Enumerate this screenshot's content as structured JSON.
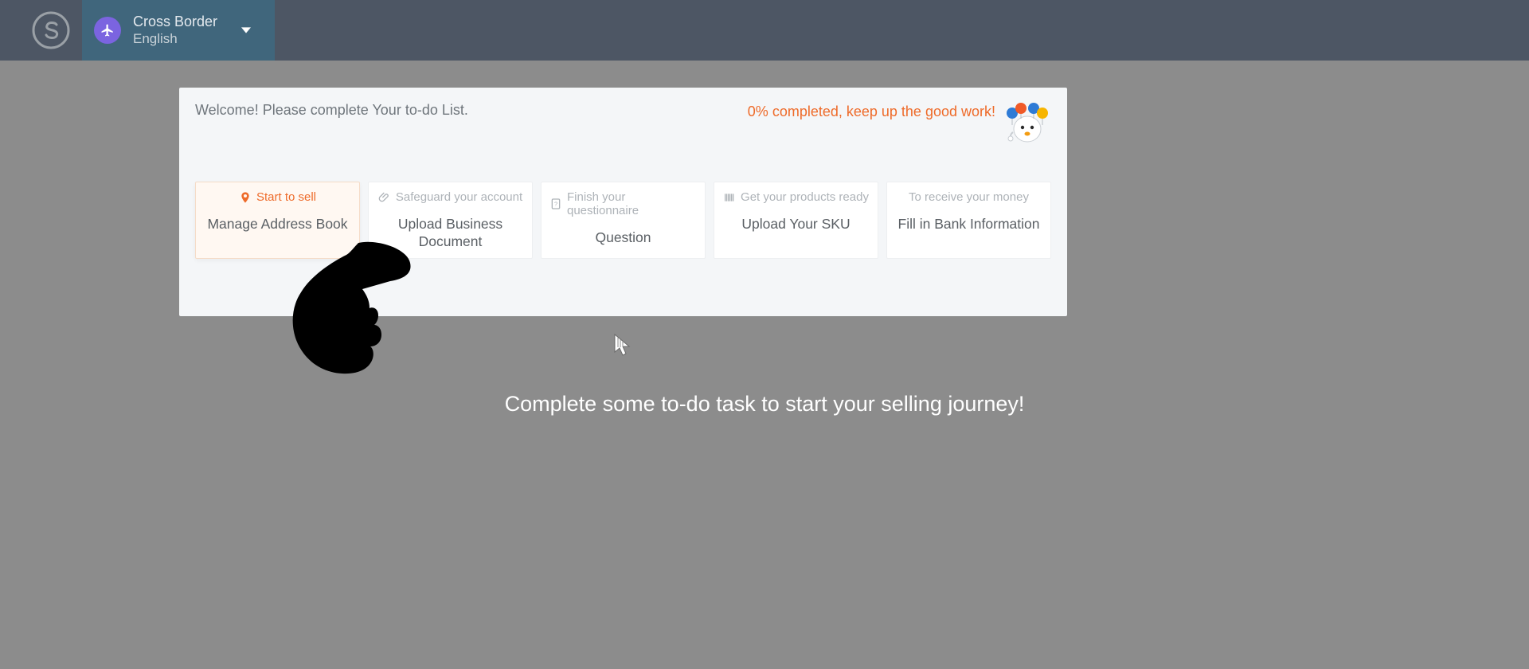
{
  "header": {
    "region_title": "Cross Border",
    "region_language": "English"
  },
  "card": {
    "welcome": "Welcome! Please complete Your to-do List.",
    "progress": "0% completed, keep up the good work!"
  },
  "tiles": [
    {
      "head": "Start to sell",
      "body": "Manage Address Book",
      "active": true
    },
    {
      "head": "Safeguard your account",
      "body": "Upload Business Document",
      "active": false
    },
    {
      "head": "Finish your questionnaire",
      "body": "Question",
      "active": false
    },
    {
      "head": "Get your products ready",
      "body": "Upload Your SKU",
      "active": false
    },
    {
      "head": "To receive your money",
      "body": "Fill in Bank Information",
      "active": false
    }
  ],
  "tagline": "Complete some to-do task to start your selling journey!"
}
